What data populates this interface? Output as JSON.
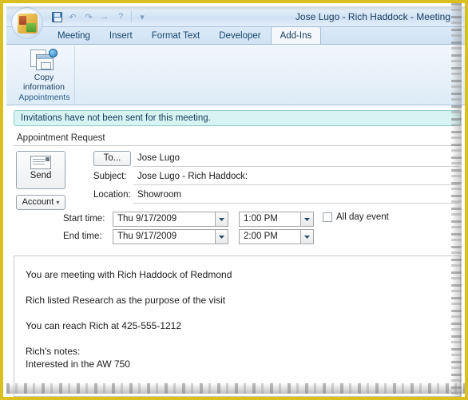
{
  "window": {
    "title": "Jose Lugo - Rich Haddock - Meeting",
    "border_color": "#d9c020"
  },
  "quick_access": {
    "items": [
      {
        "name": "save-icon",
        "glyph": ""
      },
      {
        "name": "undo-icon",
        "glyph": "↶"
      },
      {
        "name": "redo-icon",
        "glyph": "↷"
      },
      {
        "name": "forward-icon",
        "glyph": "→"
      },
      {
        "name": "help-icon",
        "glyph": "?"
      },
      {
        "name": "customize-icon",
        "glyph": "▾"
      }
    ]
  },
  "tabs": [
    {
      "label": "Meeting",
      "active": false
    },
    {
      "label": "Insert",
      "active": false
    },
    {
      "label": "Format Text",
      "active": false
    },
    {
      "label": "Developer",
      "active": false
    },
    {
      "label": "Add-Ins",
      "active": true
    }
  ],
  "ribbon": {
    "group_name": "Appointments",
    "copy_button": {
      "line1": "Copy",
      "line2": "information",
      "icon": "copy-information-icon"
    }
  },
  "infobar": {
    "message": "Invitations have not been sent for this meeting."
  },
  "section": {
    "header": "Appointment Request"
  },
  "actions": {
    "send_label": "Send",
    "account_label": "Account",
    "account_caret": "▾",
    "to_label": "To..."
  },
  "fields": {
    "to_value": "Jose Lugo",
    "subject_label": "Subject:",
    "subject_value": "Jose Lugo - Rich Haddock:",
    "location_label": "Location:",
    "location_value": "Showroom"
  },
  "schedule": {
    "start_label": "Start time:",
    "start_date": "Thu 9/17/2009",
    "start_time": "1:00 PM",
    "end_label": "End time:",
    "end_date": "Thu 9/17/2009",
    "end_time": "2:00 PM",
    "all_day_label": "All day event",
    "all_day_checked": false
  },
  "message_body": {
    "lines": [
      "You are meeting with Rich Haddock of Redmond",
      "Rich listed Research as the purpose of the visit",
      "You can reach Rich at 425-555-1212",
      "Rich's notes:",
      "Interested in the AW 750"
    ]
  }
}
